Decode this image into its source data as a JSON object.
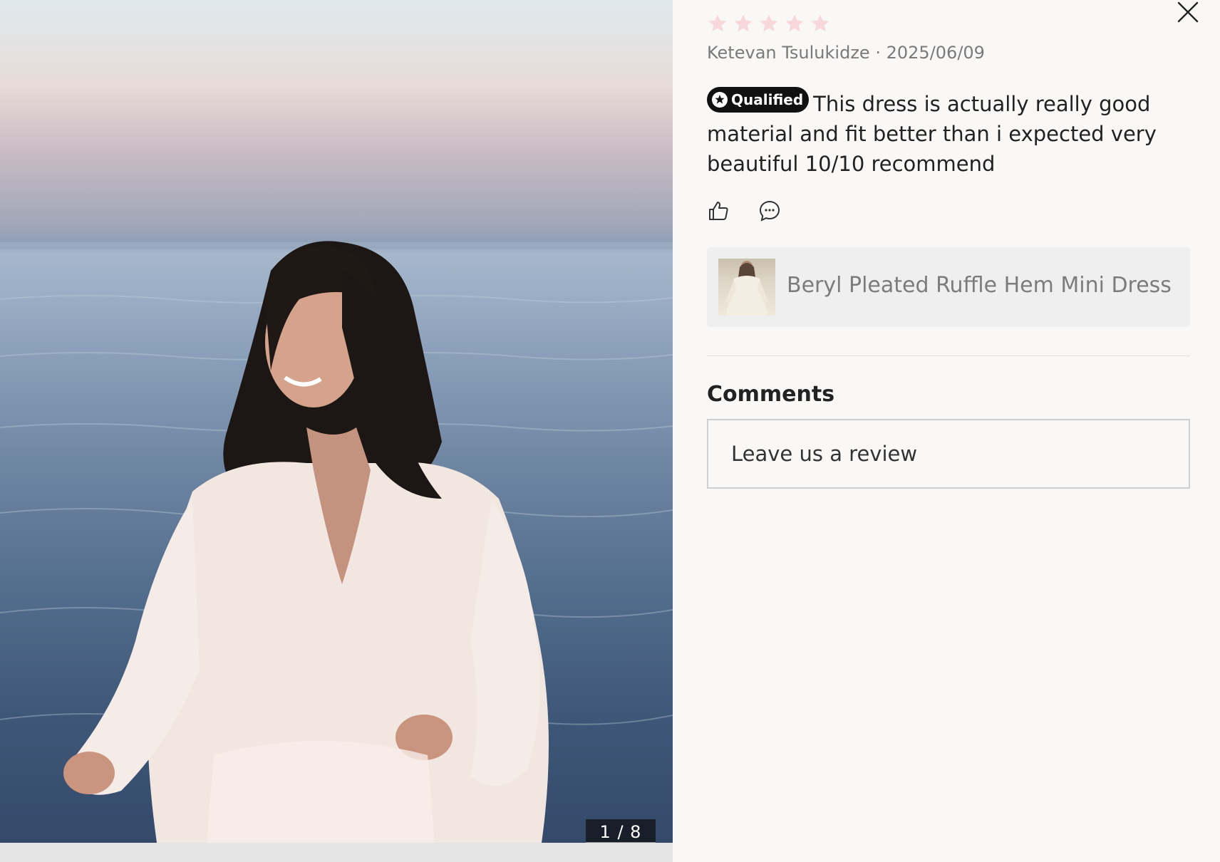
{
  "media": {
    "counter": "1 / 8"
  },
  "review": {
    "rating": 5,
    "max_rating": 5,
    "star_color": "#f7d7da",
    "author": "Ketevan Tsulukidze",
    "separator": "·",
    "date": "2025/06/09",
    "badge": "Qualified",
    "text": "This dress is actually really good material and fit better than i expected very beautiful 10/10 recommend"
  },
  "actions": {
    "like_icon": "thumbs-up-icon",
    "comment_icon": "comment-bubble-icon"
  },
  "product": {
    "name": "Beryl Pleated Ruffle Hem Mini Dress"
  },
  "comments": {
    "heading": "Comments",
    "input_placeholder": "Leave us a review"
  },
  "close_icon": "close-icon"
}
